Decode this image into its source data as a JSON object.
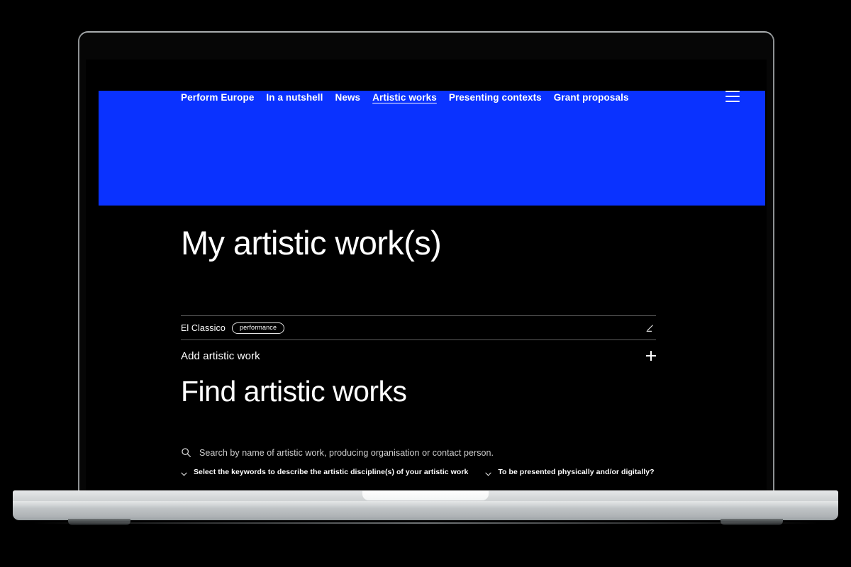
{
  "device": {
    "type": "laptop-mockup",
    "frame_color": "#c3c7c9",
    "camera_indicator_color": "#1f4d22"
  },
  "theme": {
    "background": "#000000",
    "banner_blue": "#0A32FF",
    "text": "#ffffff",
    "muted_text": "#cfcfcf",
    "divider": "#5c5c5c"
  },
  "header": {
    "nav_items": [
      {
        "label": "Perform Europe",
        "active": false
      },
      {
        "label": "In a nutshell",
        "active": false
      },
      {
        "label": "News",
        "active": false
      },
      {
        "label": "Artistic works",
        "active": true
      },
      {
        "label": "Presenting contexts",
        "active": false
      },
      {
        "label": "Grant proposals",
        "active": false
      }
    ],
    "menu_icon": "hamburger-icon"
  },
  "main": {
    "page_title": "My artistic work(s)",
    "works": [
      {
        "name": "El Classico",
        "tag": "performance",
        "edit_icon": "pencil-icon"
      }
    ],
    "add_work": {
      "label": "Add artistic work",
      "icon": "plus-icon"
    },
    "find_section": {
      "title": "Find artistic works",
      "search": {
        "icon": "search-icon",
        "value": "",
        "placeholder": "Search by name of artistic work, producing organisation or contact person."
      },
      "filters": [
        {
          "label": "Select the keywords to describe the artistic discipline(s) of your artistic work",
          "icon": "chevron-down-icon"
        },
        {
          "label": "To be presented physically and/or digitally?",
          "icon": "chevron-down-icon"
        }
      ]
    }
  }
}
